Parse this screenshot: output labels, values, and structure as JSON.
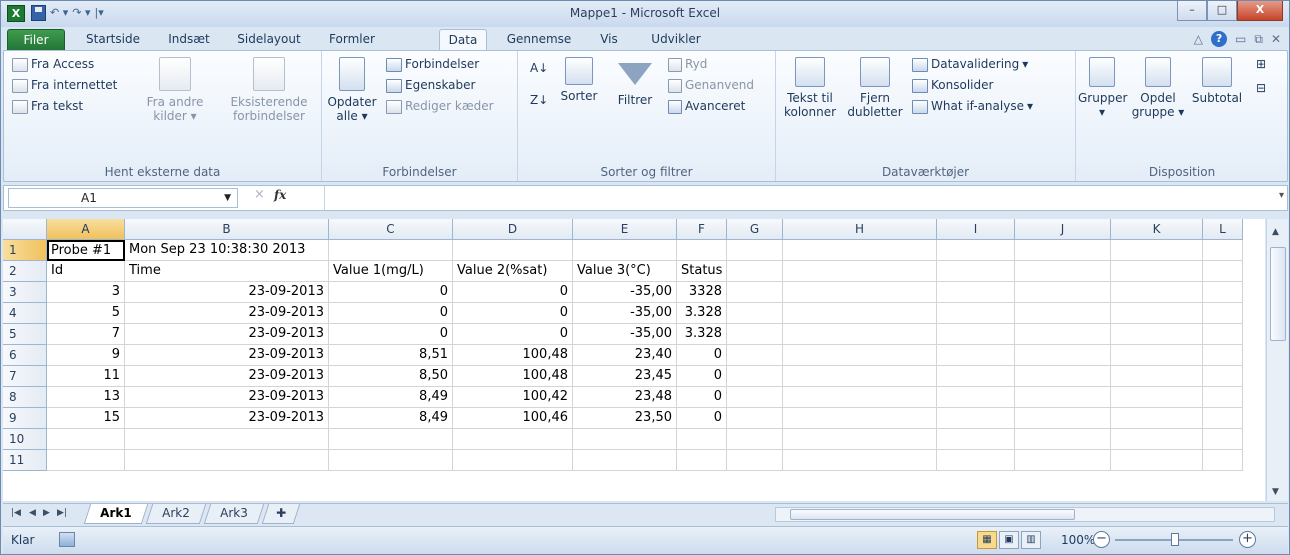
{
  "window": {
    "title": "Mappe1 - Microsoft Excel",
    "app_icon": "X",
    "min": "–",
    "max": "□",
    "close": "X"
  },
  "tabs": [
    "Filer",
    "Startside",
    "Indsæt",
    "Sidelayout",
    "Formler",
    "Data",
    "Gennemse",
    "Vis",
    "Udvikler"
  ],
  "active_tab": "Data",
  "ribbon": {
    "ext": {
      "access": "Fra Access",
      "web": "Fra internettet",
      "text": "Fra tekst",
      "other1": "Fra andre",
      "other2": "kilder",
      "exist1": "Eksisterende",
      "exist2": "forbindelser",
      "label": "Hent eksterne data"
    },
    "conn": {
      "refresh1": "Opdater",
      "refresh2": "alle",
      "connections": "Forbindelser",
      "properties": "Egenskaber",
      "edit_links": "Rediger kæder",
      "label": "Forbindelser"
    },
    "sort": {
      "sort": "Sorter",
      "filter": "Filtrer",
      "clear": "Ryd",
      "reapply": "Genanvend",
      "advanced": "Avanceret",
      "label": "Sorter og filtrer"
    },
    "tools": {
      "t2c1": "Tekst til",
      "t2c2": "kolonner",
      "dup1": "Fjern",
      "dup2": "dubletter",
      "validation": "Datavalidering",
      "consolidate": "Konsolider",
      "whatif": "What if-analyse",
      "label": "Dataværktøjer"
    },
    "outline": {
      "group": "Grupper",
      "ungroup1": "Opdel",
      "ungroup2": "gruppe",
      "subtotal": "Subtotal",
      "label": "Disposition"
    }
  },
  "formula_bar": {
    "name_box": "A1",
    "fx": "fx",
    "cancel": "×",
    "value": ""
  },
  "columns": [
    "A",
    "B",
    "C",
    "D",
    "E",
    "F",
    "G",
    "H",
    "I",
    "J",
    "K",
    "L"
  ],
  "rows": [
    "1",
    "2",
    "3",
    "4",
    "5",
    "6",
    "7",
    "8",
    "9",
    "10",
    "11"
  ],
  "cells": {
    "r1": [
      "Probe #1",
      "Mon Sep 23 10:38:30 2013",
      "",
      "",
      "",
      ""
    ],
    "r2": [
      "Id",
      "Time",
      "Value 1(mg/L)",
      "Value 2(%sat)",
      "Value 3(°C)",
      "Status"
    ],
    "data": [
      [
        "3",
        "23-09-2013",
        "0",
        "0",
        "-35,00",
        "3328"
      ],
      [
        "5",
        "23-09-2013",
        "0",
        "0",
        "-35,00",
        "3.328"
      ],
      [
        "7",
        "23-09-2013",
        "0",
        "0",
        "-35,00",
        "3.328"
      ],
      [
        "9",
        "23-09-2013",
        "8,51",
        "100,48",
        "23,40",
        "0"
      ],
      [
        "11",
        "23-09-2013",
        "8,50",
        "100,48",
        "23,45",
        "0"
      ],
      [
        "13",
        "23-09-2013",
        "8,49",
        "100,42",
        "23,48",
        "0"
      ],
      [
        "15",
        "23-09-2013",
        "8,49",
        "100,46",
        "23,50",
        "0"
      ]
    ]
  },
  "sheets": [
    "Ark1",
    "Ark2",
    "Ark3"
  ],
  "active_sheet": "Ark1",
  "status": {
    "ready": "Klar",
    "zoom": "100%",
    "zoom_minus": "−",
    "zoom_plus": "+"
  }
}
